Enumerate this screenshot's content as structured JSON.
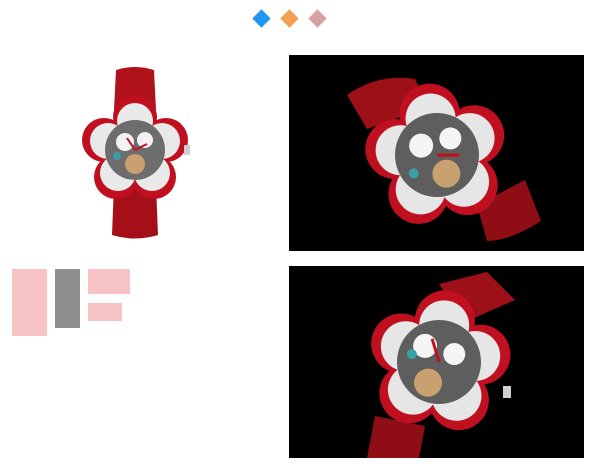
{
  "slider_dots": [
    {
      "name": "slide-dot-1",
      "color": "#2196f3",
      "active": true
    },
    {
      "name": "slide-dot-2",
      "color": "#f0a050",
      "active": false
    },
    {
      "name": "slide-dot-3",
      "color": "#d9a0a0",
      "active": false
    }
  ],
  "gallery": {
    "items": [
      {
        "name": "watch-front-view",
        "background": "#ffffff"
      },
      {
        "name": "watch-angle-view-1",
        "background": "#000000"
      },
      {
        "name": "watch-angle-view-2",
        "background": "#000000"
      }
    ]
  },
  "colors": {
    "strap_red": "#b0121c",
    "ruby_red": "#c01020",
    "case_silver": "#d9d9d9",
    "placeholder_pink": "#f7c3c5",
    "placeholder_gray": "#8f8f8f"
  }
}
